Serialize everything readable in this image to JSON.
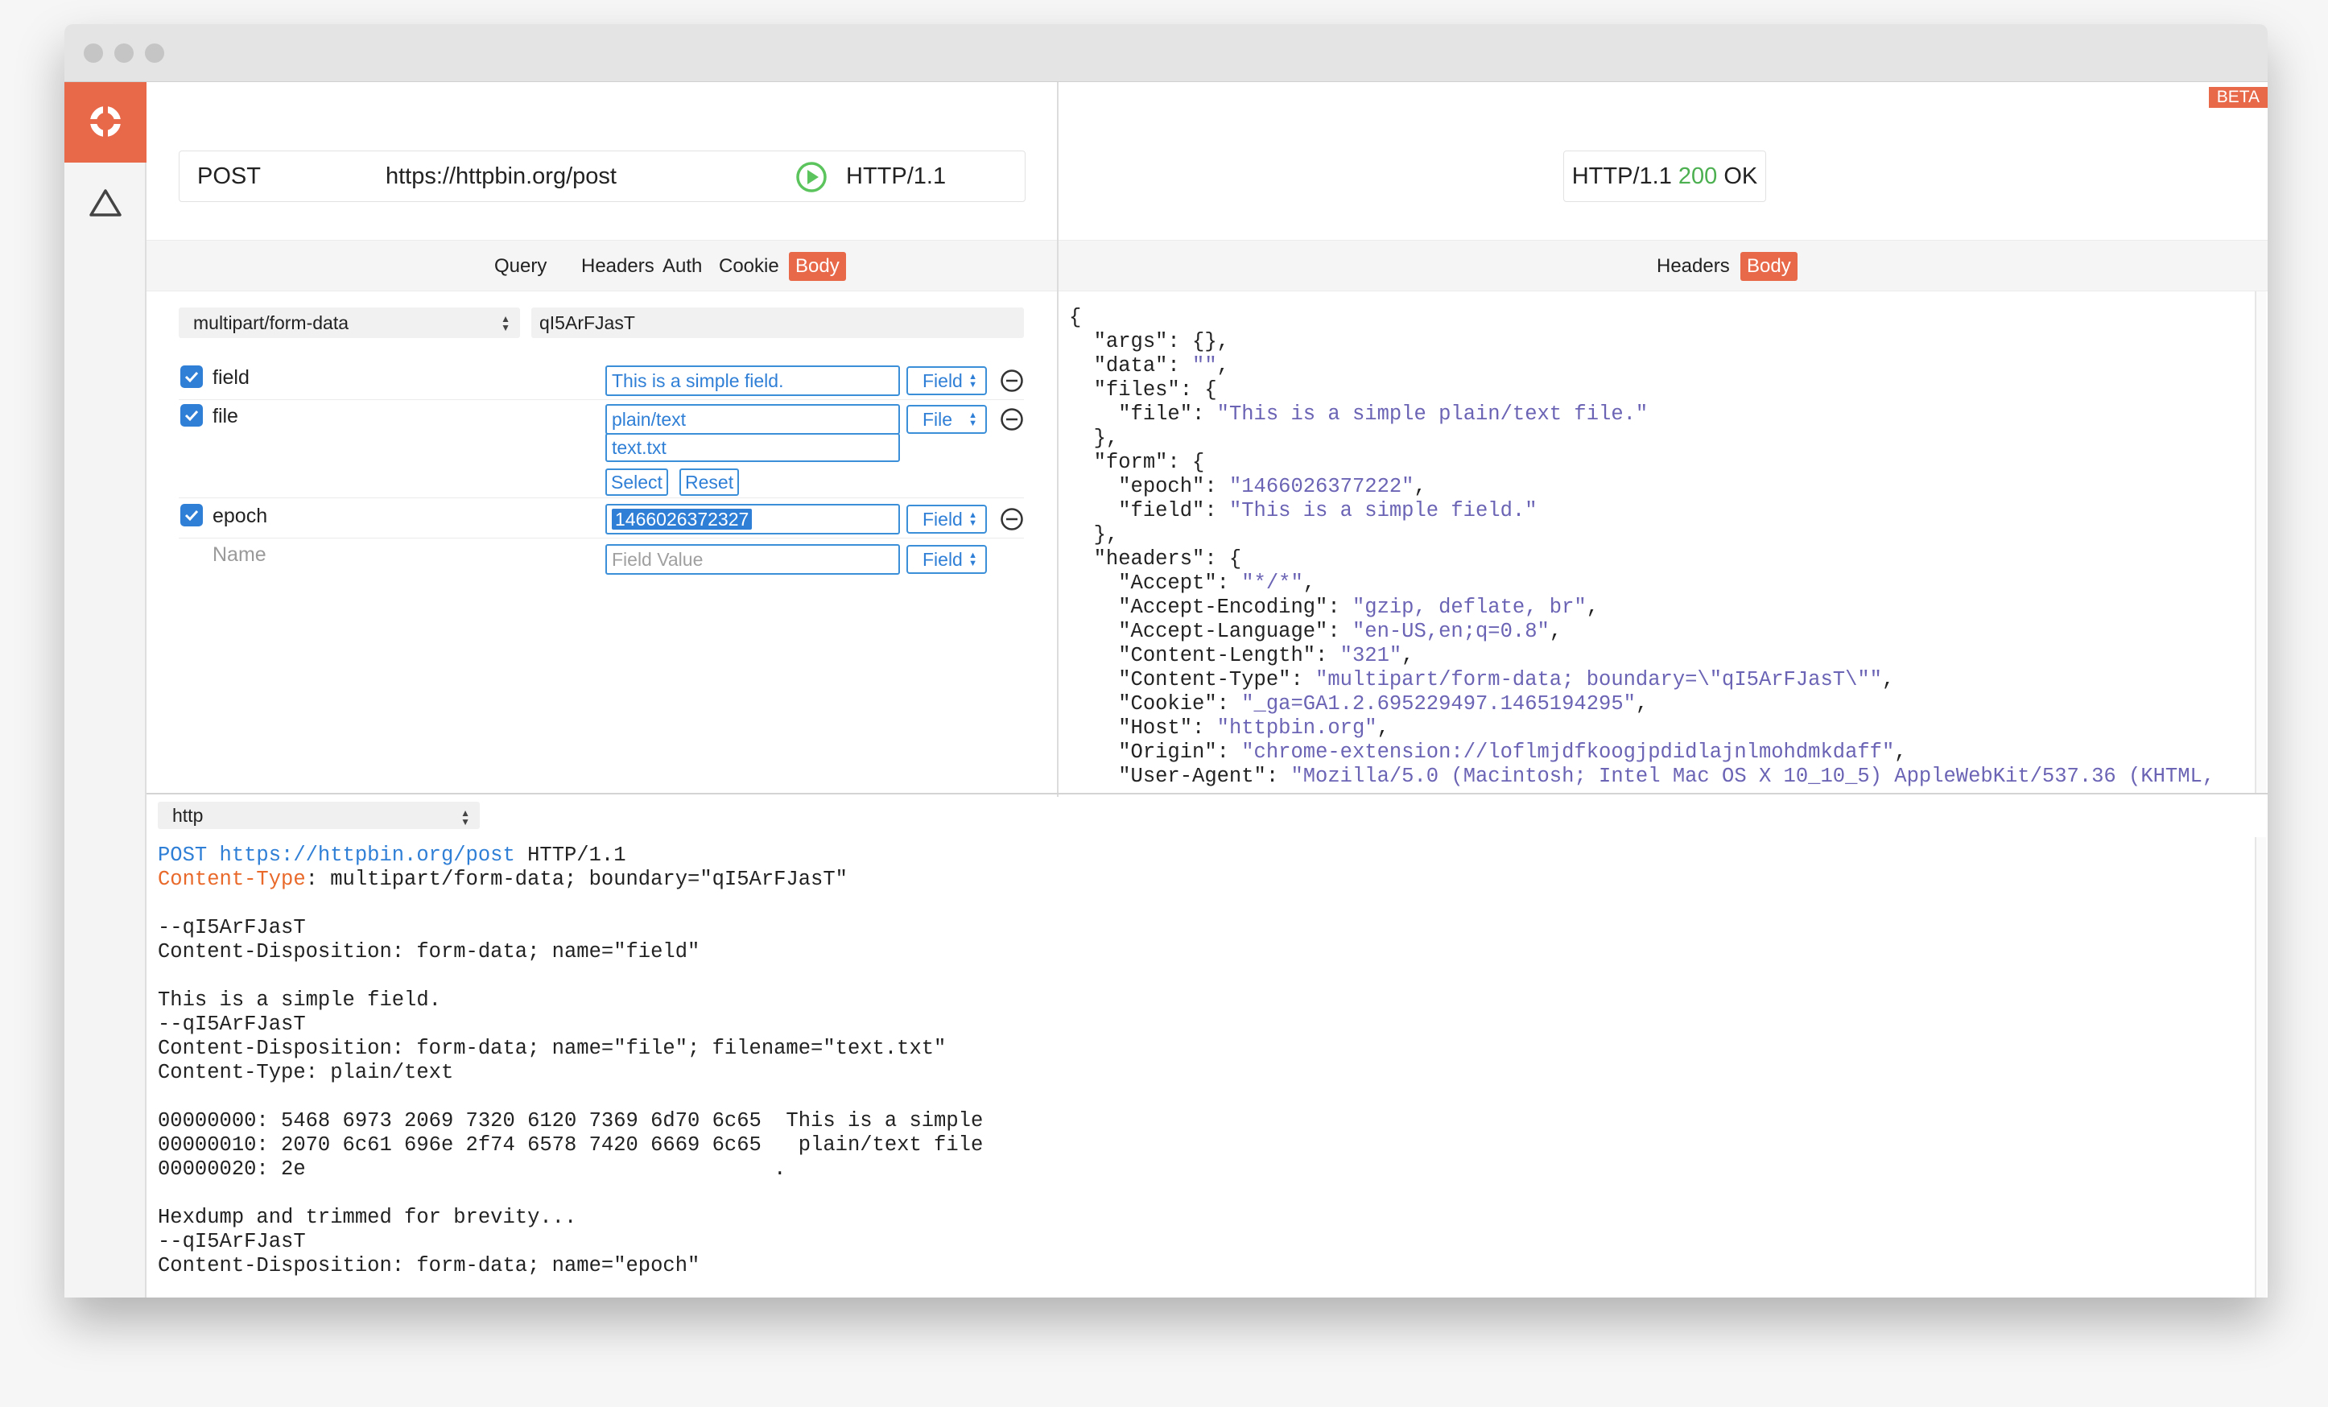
{
  "window": {
    "beta_label": "BETA",
    "sidebar": [
      {
        "icon": "lifebuoy-logo-icon"
      },
      {
        "icon": "triangle-icon"
      }
    ]
  },
  "request": {
    "method": "POST",
    "url": "https://httpbin.org/post",
    "protocol": "HTTP/1.1",
    "tabs": [
      {
        "label": "Query",
        "active": false
      },
      {
        "label": "Headers",
        "active": false
      },
      {
        "label": "Auth",
        "active": false
      },
      {
        "label": "Cookie",
        "active": false
      },
      {
        "label": "Body",
        "active": true
      }
    ],
    "body_type": "multipart/form-data",
    "boundary": "qI5ArFJasT",
    "fields": [
      {
        "name": "field",
        "checked": true,
        "value": "This is a simple field.",
        "type": "Field"
      },
      {
        "name": "file",
        "checked": true,
        "content_type": "plain/text",
        "filename": "text.txt",
        "type": "File",
        "select_label": "Select",
        "reset_label": "Reset"
      },
      {
        "name": "epoch",
        "checked": true,
        "value": "1466026372327",
        "type": "Field"
      }
    ],
    "new_field": {
      "name_placeholder": "Name",
      "value_placeholder": "Field Value",
      "type": "Field"
    }
  },
  "response": {
    "protocol": "HTTP/1.1",
    "status_code": "200",
    "status_text": "OK",
    "tabs": [
      {
        "label": "Headers",
        "active": false
      },
      {
        "label": "Body",
        "active": true
      }
    ],
    "body_lines": [
      [
        [
          "{",
          ""
        ]
      ],
      [
        [
          "  \"args\": {},",
          ""
        ]
      ],
      [
        [
          "  \"data\": ",
          ""
        ],
        [
          "\"\"",
          "s"
        ],
        [
          ",",
          ""
        ]
      ],
      [
        [
          "  \"files\": {",
          ""
        ]
      ],
      [
        [
          "    \"file\": ",
          ""
        ],
        [
          "\"This is a simple plain/text file.\"",
          "s"
        ]
      ],
      [
        [
          "  },",
          ""
        ]
      ],
      [
        [
          "  \"form\": {",
          ""
        ]
      ],
      [
        [
          "    \"epoch\": ",
          ""
        ],
        [
          "\"1466026377222\"",
          "s"
        ],
        [
          ",",
          ""
        ]
      ],
      [
        [
          "    \"field\": ",
          ""
        ],
        [
          "\"This is a simple field.\"",
          "s"
        ]
      ],
      [
        [
          "  },",
          ""
        ]
      ],
      [
        [
          "  \"headers\": {",
          ""
        ]
      ],
      [
        [
          "    \"Accept\": ",
          ""
        ],
        [
          "\"*/*\"",
          "s"
        ],
        [
          ",",
          ""
        ]
      ],
      [
        [
          "    \"Accept-Encoding\": ",
          ""
        ],
        [
          "\"gzip, deflate, br\"",
          "s"
        ],
        [
          ",",
          ""
        ]
      ],
      [
        [
          "    \"Accept-Language\": ",
          ""
        ],
        [
          "\"en-US,en;q=0.8\"",
          "s"
        ],
        [
          ",",
          ""
        ]
      ],
      [
        [
          "    \"Content-Length\": ",
          ""
        ],
        [
          "\"321\"",
          "s"
        ],
        [
          ",",
          ""
        ]
      ],
      [
        [
          "    \"Content-Type\": ",
          ""
        ],
        [
          "\"multipart/form-data; boundary=\\\"qI5ArFJasT\\\"\"",
          "s"
        ],
        [
          ",",
          ""
        ]
      ],
      [
        [
          "    \"Cookie\": ",
          ""
        ],
        [
          "\"_ga=GA1.2.695229497.1465194295\"",
          "s"
        ],
        [
          ",",
          ""
        ]
      ],
      [
        [
          "    \"Host\": ",
          ""
        ],
        [
          "\"httpbin.org\"",
          "s"
        ],
        [
          ",",
          ""
        ]
      ],
      [
        [
          "    \"Origin\": ",
          ""
        ],
        [
          "\"chrome-extension://loflmjdfkoogjpdidlajnlmohdmkdaff\"",
          "s"
        ],
        [
          ",",
          ""
        ]
      ],
      [
        [
          "    \"User-Agent\": ",
          ""
        ],
        [
          "\"Mozilla/5.0 (Macintosh; Intel Mac OS X 10_10_5) AppleWebKit/537.36 (KHTML,",
          "s"
        ]
      ]
    ]
  },
  "preview": {
    "format": "http",
    "lines": [
      [
        [
          "POST https://httpbin.org/post",
          "m"
        ],
        [
          " HTTP/1.1",
          ""
        ]
      ],
      [
        [
          "Content-Type",
          "h"
        ],
        [
          ": multipart/form-data; boundary=\"qI5ArFJasT\"",
          ""
        ]
      ],
      [
        [
          "",
          ""
        ]
      ],
      [
        [
          "--qI5ArFJasT",
          ""
        ]
      ],
      [
        [
          "Content-Disposition: form-data; name=\"field\"",
          ""
        ]
      ],
      [
        [
          "",
          ""
        ]
      ],
      [
        [
          "This is a simple field.",
          ""
        ]
      ],
      [
        [
          "--qI5ArFJasT",
          ""
        ]
      ],
      [
        [
          "Content-Disposition: form-data; name=\"file\"; filename=\"text.txt\"",
          ""
        ]
      ],
      [
        [
          "Content-Type: plain/text",
          ""
        ]
      ],
      [
        [
          "",
          ""
        ]
      ],
      [
        [
          "00000000: 5468 6973 2069 7320 6120 7369 6d70 6c65  This is a simple",
          ""
        ]
      ],
      [
        [
          "00000010: 2070 6c61 696e 2f74 6578 7420 6669 6c65   plain/text file",
          ""
        ]
      ],
      [
        [
          "00000020: 2e                                      .",
          ""
        ]
      ],
      [
        [
          "",
          ""
        ]
      ],
      [
        [
          "Hexdump and trimmed for brevity...",
          ""
        ]
      ],
      [
        [
          "--qI5ArFJasT",
          ""
        ]
      ],
      [
        [
          "Content-Disposition: form-data; name=\"epoch\"",
          ""
        ]
      ]
    ]
  }
}
